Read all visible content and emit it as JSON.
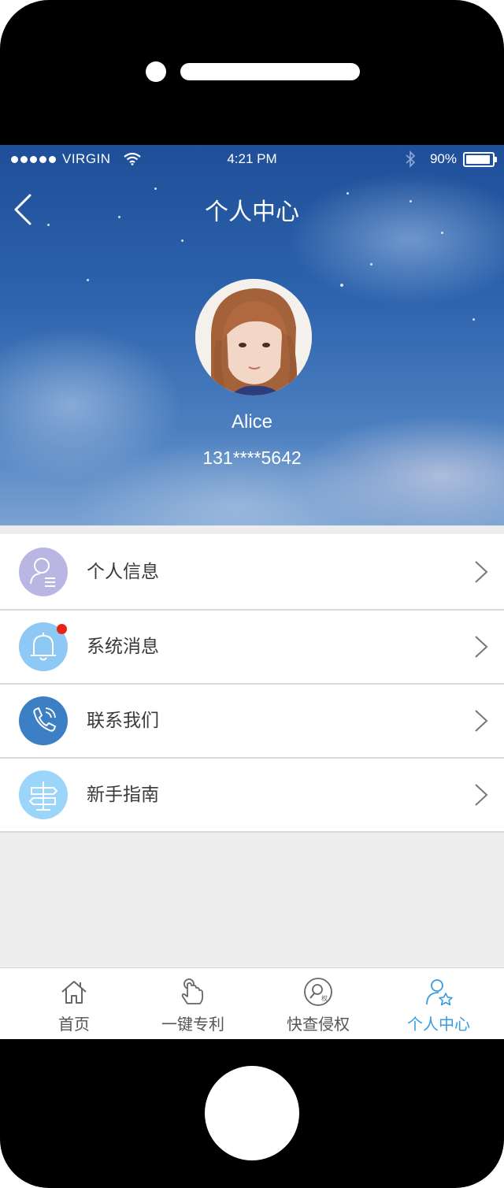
{
  "status_bar": {
    "carrier": "VIRGIN",
    "time": "4:21 PM",
    "battery": "90%"
  },
  "header": {
    "title": "个人中心"
  },
  "profile": {
    "name": "Alice",
    "phone": "131****5642"
  },
  "menu": {
    "items": [
      {
        "label": "个人信息",
        "icon": "user-info-icon",
        "color": "#b9b6e4"
      },
      {
        "label": "系统消息",
        "icon": "bell-icon",
        "color": "#8ec8f5",
        "badge": true
      },
      {
        "label": "联系我们",
        "icon": "phone-icon",
        "color": "#3d7fc4"
      },
      {
        "label": "新手指南",
        "icon": "signpost-icon",
        "color": "#9cd5fa"
      }
    ]
  },
  "tab_bar": {
    "tabs": [
      {
        "label": "首页",
        "icon": "home-icon"
      },
      {
        "label": "一键专利",
        "icon": "tap-hand-icon"
      },
      {
        "label": "快查侵权",
        "icon": "search-rights-icon"
      },
      {
        "label": "个人中心",
        "icon": "profile-star-icon",
        "active": true
      }
    ],
    "active_color": "#3a9be0"
  }
}
